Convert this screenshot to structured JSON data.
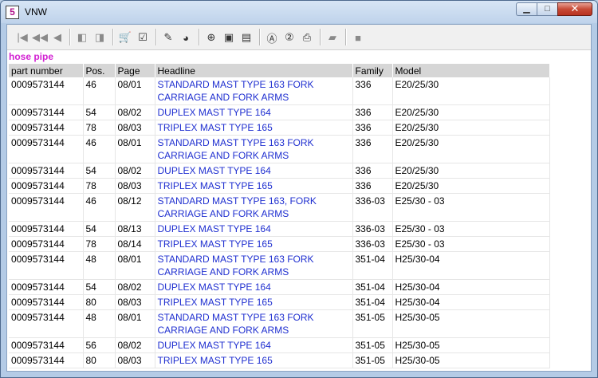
{
  "window": {
    "title": "VNW",
    "app_icon_letter": "5",
    "minimize": "▁",
    "maximize": "□",
    "close": "✕"
  },
  "toolbar": {
    "buttons": [
      {
        "icon": "first-record-icon",
        "glyph": "|◀"
      },
      {
        "icon": "fast-back-icon",
        "glyph": "◀◀"
      },
      {
        "icon": "back-icon",
        "glyph": "◀"
      },
      {
        "icon": "prev-page-icon",
        "glyph": "◧"
      },
      {
        "icon": "next-page-icon",
        "glyph": "◨"
      },
      {
        "icon": "cart-icon",
        "glyph": "🛒"
      },
      {
        "icon": "checklist-icon",
        "glyph": "☑"
      },
      {
        "icon": "pen-icon",
        "glyph": "✎"
      },
      {
        "icon": "globe-icon",
        "glyph": "◕"
      },
      {
        "icon": "zoom-icon",
        "glyph": "⊕"
      },
      {
        "icon": "page-icon",
        "glyph": "▣"
      },
      {
        "icon": "page-alt-icon",
        "glyph": "▤"
      },
      {
        "icon": "info-a-icon",
        "glyph": "Ⓐ"
      },
      {
        "icon": "help-icon",
        "glyph": "②"
      },
      {
        "icon": "print-icon",
        "glyph": "⎙"
      },
      {
        "icon": "notes-icon",
        "glyph": "▰"
      },
      {
        "icon": "stop-icon",
        "glyph": "■"
      }
    ]
  },
  "heading": "hose pipe",
  "table": {
    "headers": [
      "part number",
      "Pos.",
      "Page",
      "Headline",
      "Family",
      "Model"
    ],
    "rows": [
      [
        "0009573144",
        "46",
        "08/01",
        "STANDARD MAST TYPE 163  FORK CARRIAGE AND FORK ARMS",
        "336",
        "E20/25/30"
      ],
      [
        "0009573144",
        "54",
        "08/02",
        "DUPLEX MAST TYPE 164",
        "336",
        "E20/25/30"
      ],
      [
        "0009573144",
        "78",
        "08/03",
        "TRIPLEX MAST TYPE 165",
        "336",
        "E20/25/30"
      ],
      [
        "0009573144",
        "46",
        "08/01",
        "STANDARD MAST TYPE 163  FORK CARRIAGE AND FORK ARMS",
        "336",
        "E20/25/30"
      ],
      [
        "0009573144",
        "54",
        "08/02",
        "DUPLEX MAST TYPE 164",
        "336",
        "E20/25/30"
      ],
      [
        "0009573144",
        "78",
        "08/03",
        "TRIPLEX MAST TYPE 165",
        "336",
        "E20/25/30"
      ],
      [
        "0009573144",
        "46",
        "08/12",
        "STANDARD MAST TYPE 163, FORK CARRIAGE AND FORK ARMS",
        "336-03",
        "E25/30 - 03"
      ],
      [
        "0009573144",
        "54",
        "08/13",
        "DUPLEX MAST TYPE 164",
        "336-03",
        "E25/30 - 03"
      ],
      [
        "0009573144",
        "78",
        "08/14",
        "TRIPLEX MAST TYPE 165",
        "336-03",
        "E25/30 - 03"
      ],
      [
        "0009573144",
        "48",
        "08/01",
        "STANDARD MAST TYPE 163 FORK CARRIAGE AND FORK ARMS",
        "351-04",
        "H25/30-04"
      ],
      [
        "0009573144",
        "54",
        "08/02",
        "DUPLEX MAST TYPE 164",
        "351-04",
        "H25/30-04"
      ],
      [
        "0009573144",
        "80",
        "08/03",
        "TRIPLEX MAST TYPE 165",
        "351-04",
        "H25/30-04"
      ],
      [
        "0009573144",
        "48",
        "08/01",
        "STANDARD MAST TYPE 163 FORK CARRIAGE AND FORK ARMS",
        "351-05",
        "H25/30-05"
      ],
      [
        "0009573144",
        "56",
        "08/02",
        "DUPLEX MAST TYPE 164",
        "351-05",
        "H25/30-05"
      ],
      [
        "0009573144",
        "80",
        "08/03",
        "TRIPLEX MAST TYPE 165",
        "351-05",
        "H25/30-05"
      ]
    ]
  }
}
